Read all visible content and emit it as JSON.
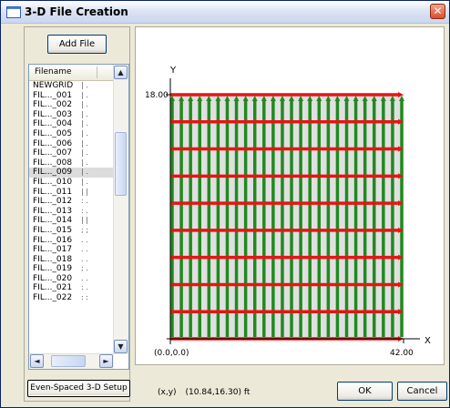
{
  "window": {
    "title": "3-D File Creation",
    "close_glyph": "✕",
    "app_icon": "window-icon"
  },
  "left": {
    "add_file_label": "Add File",
    "column_header": "Filename",
    "files": [
      {
        "name": "NEWGRID",
        "mark": "| ."
      },
      {
        "name": "FIL..._001",
        "mark": "| ."
      },
      {
        "name": "FIL..._002",
        "mark": "| ."
      },
      {
        "name": "FIL..._003",
        "mark": "| ."
      },
      {
        "name": "FIL..._004",
        "mark": "| ."
      },
      {
        "name": "FIL..._005",
        "mark": "| ."
      },
      {
        "name": "FIL..._006",
        "mark": "| ."
      },
      {
        "name": "FIL..._007",
        "mark": "| ."
      },
      {
        "name": "FIL..._008",
        "mark": "| ."
      },
      {
        "name": "FIL..._009",
        "mark": "| ."
      },
      {
        "name": "FIL..._010",
        "mark": "| ."
      },
      {
        "name": "FIL..._011",
        "mark": "| |"
      },
      {
        "name": "FIL..._012",
        "mark": ": ."
      },
      {
        "name": "FIL..._013",
        "mark": ": ."
      },
      {
        "name": "FIL..._014",
        "mark": "| |"
      },
      {
        "name": "FIL..._015",
        "mark": "; ;"
      },
      {
        "name": "FIL..._016",
        "mark": ". ."
      },
      {
        "name": "FIL..._017",
        "mark": ". ."
      },
      {
        "name": "FIL..._018",
        "mark": ". ."
      },
      {
        "name": "FIL..._019",
        "mark": "; ."
      },
      {
        "name": "FIL..._020",
        "mark": ". ."
      },
      {
        "name": "FIL..._021",
        "mark": ": ."
      },
      {
        "name": "FIL..._022",
        "mark": ": :"
      }
    ],
    "selected_index": 9,
    "scroll_up": "▲",
    "scroll_down": "▼",
    "scroll_left": "◄",
    "scroll_right": "►",
    "setup_button_label": "Even-Spaced 3-D Setup"
  },
  "plot": {
    "y_axis_label": "Y",
    "x_axis_label": "X",
    "y_max_label": "18.00",
    "x_max_label": "42.00",
    "origin_label": "(0.0,0.0)",
    "vertical_lines": 26,
    "horizontal_lines": 10,
    "colors": {
      "vertical": "#1f8a1f",
      "horizontal": "#e81414",
      "fill": "#e0e0e0",
      "axis": "#000000"
    }
  },
  "status": {
    "label": "(x,y)",
    "value": "(10.84,16.30) ft"
  },
  "footer": {
    "ok_label": "OK",
    "cancel_label": "Cancel"
  }
}
